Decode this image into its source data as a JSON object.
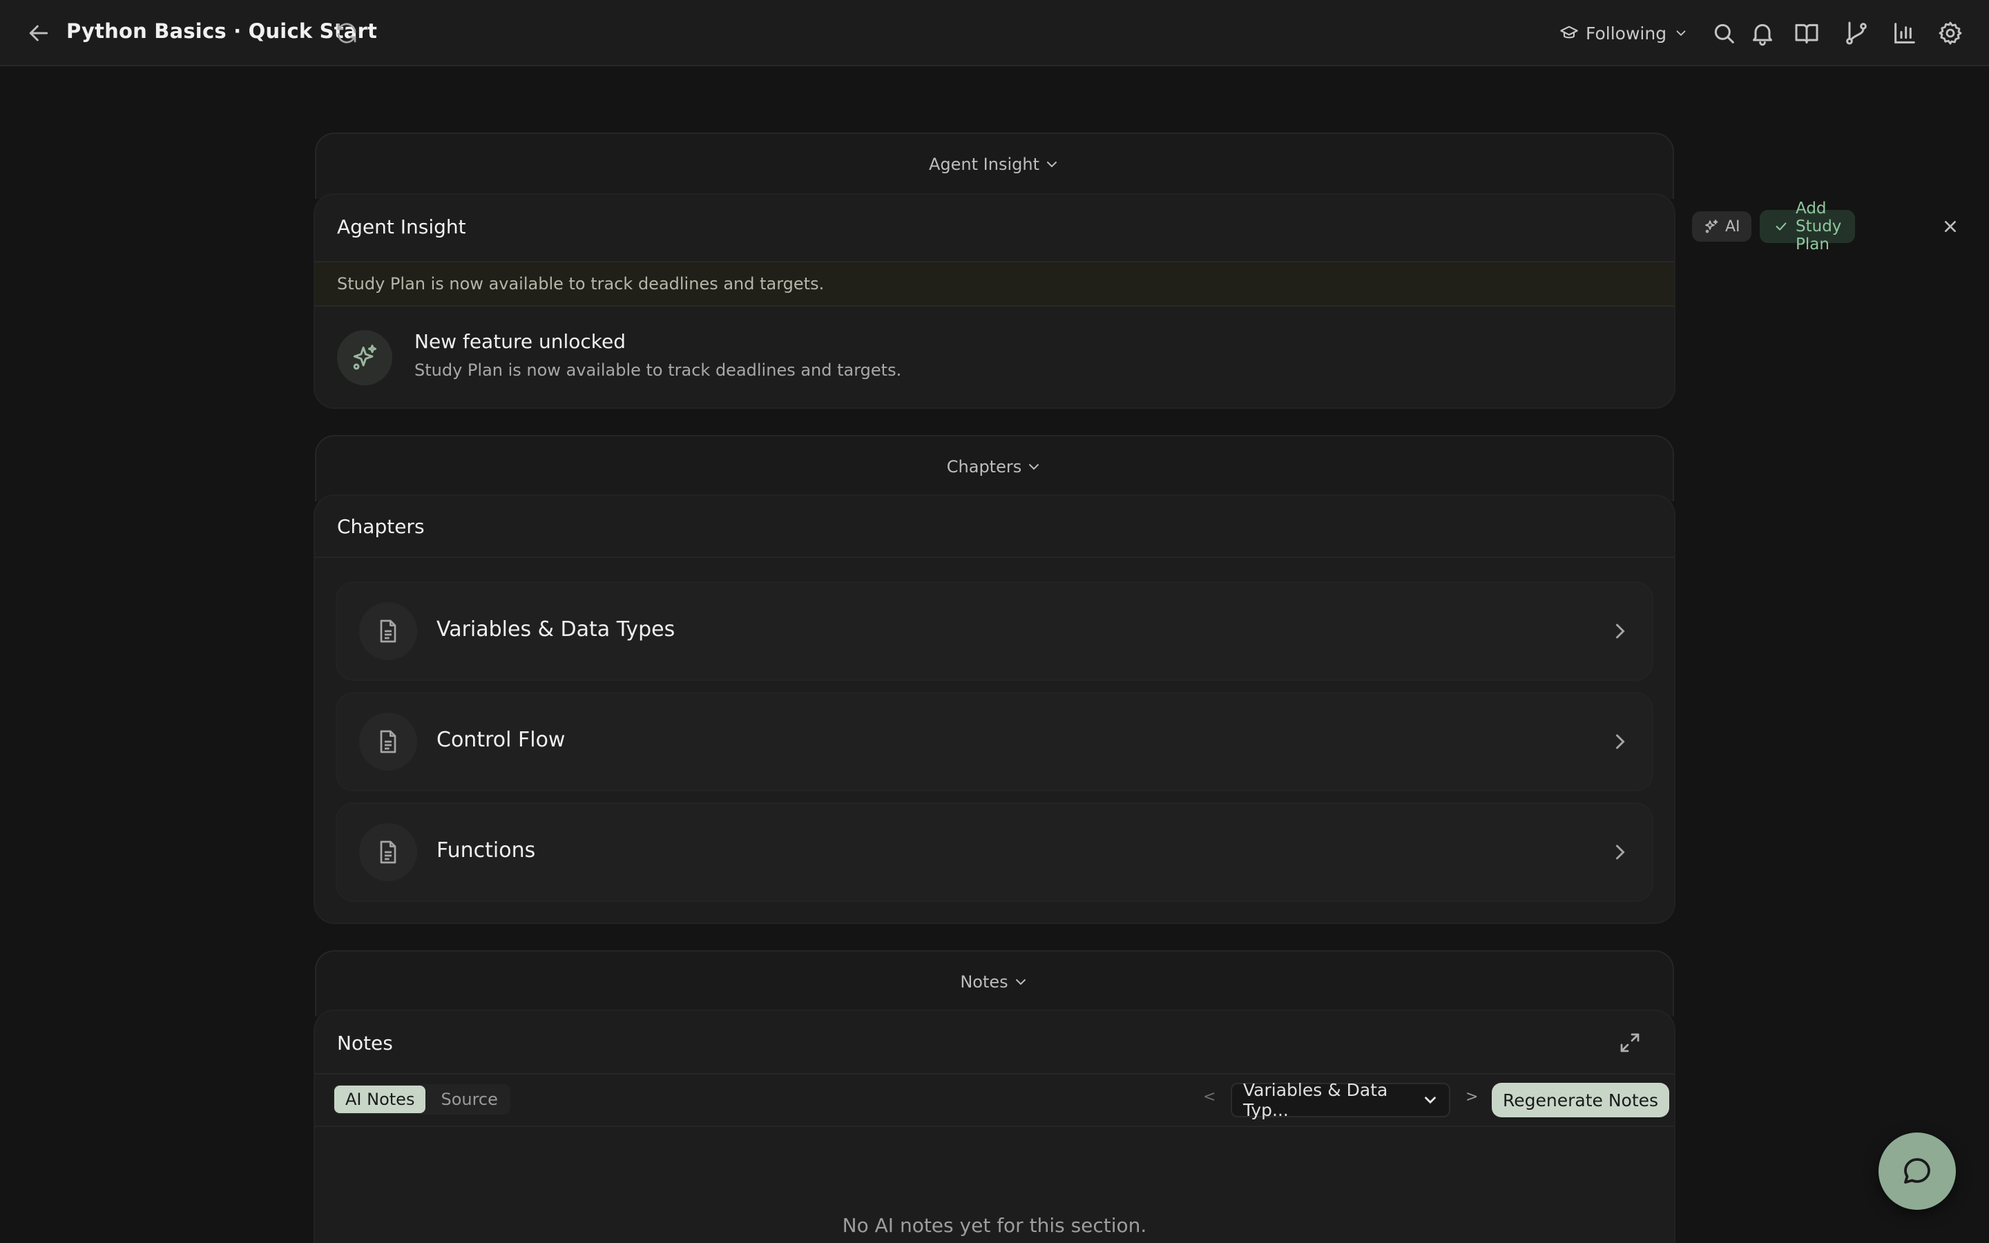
{
  "header": {
    "title": "Python Basics · Quick Start",
    "following_label": "Following"
  },
  "insight_section": {
    "toggle_label": "Agent Insight",
    "title": "Agent Insight",
    "ai_badge": "AI",
    "add_button": "Add Study Plan",
    "banner_text": "Study Plan is now available to track deadlines and targets.",
    "feature_title": "New feature unlocked",
    "feature_desc": "Study Plan is now available to track deadlines and targets."
  },
  "chapters_section": {
    "toggle_label": "Chapters",
    "title": "Chapters",
    "items": [
      {
        "label": "Variables & Data Types"
      },
      {
        "label": "Control Flow"
      },
      {
        "label": "Functions"
      }
    ]
  },
  "notes_section": {
    "toggle_label": "Notes",
    "title": "Notes",
    "tabs": [
      {
        "label": "AI Notes",
        "active": true
      },
      {
        "label": "Source",
        "active": false
      }
    ],
    "prev_label": "<",
    "next_label": ">",
    "selected_chapter": "Variables & Data Typ...",
    "regenerate_label": "Regenerate Notes",
    "empty_text": "No AI notes yet for this section."
  },
  "icons": {
    "back": "arrow-left-icon",
    "refresh": "refresh-icon",
    "graduation": "graduation-cap-icon",
    "search": "search-icon",
    "bell": "bell-icon",
    "book": "book-open-icon",
    "branch": "git-branch-icon",
    "chart": "bar-chart-icon",
    "settings": "gear-icon",
    "chat": "chat-bubble-icon"
  },
  "colors": {
    "background": "#141414",
    "accent_green": "#8fc89e",
    "fab": "#8fab94"
  }
}
